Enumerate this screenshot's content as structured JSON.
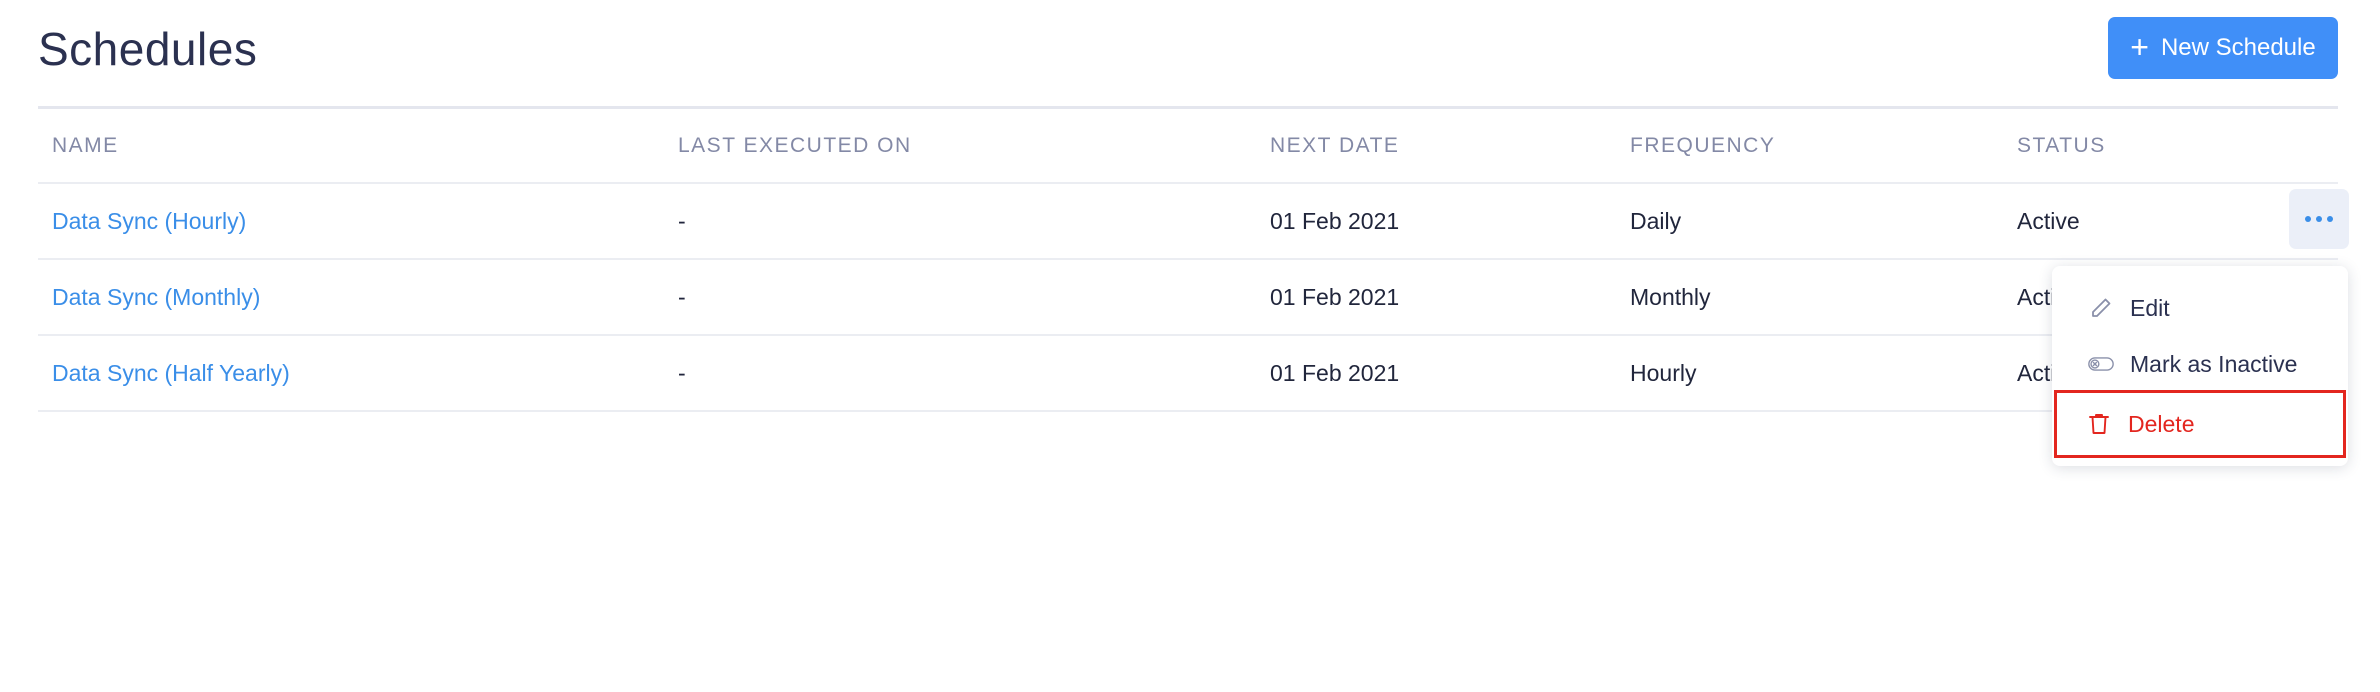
{
  "page": {
    "title": "Schedules",
    "new_button_label": "New Schedule",
    "new_button_icon": "plus-icon"
  },
  "table": {
    "columns": [
      "NAME",
      "LAST EXECUTED ON",
      "NEXT DATE",
      "FREQUENCY",
      "STATUS"
    ],
    "rows": [
      {
        "name": "Data Sync (Hourly)",
        "last_executed": "-",
        "next_date": "01 Feb 2021",
        "frequency": "Daily",
        "status": "Active"
      },
      {
        "name": "Data Sync (Monthly)",
        "last_executed": "-",
        "next_date": "01 Feb 2021",
        "frequency": "Monthly",
        "status": "Active"
      },
      {
        "name": "Data Sync (Half Yearly)",
        "last_executed": "-",
        "next_date": "01 Feb 2021",
        "frequency": "Hourly",
        "status": "Active"
      }
    ]
  },
  "row_menu": {
    "trigger_icon": "more-horizontal-icon",
    "items": [
      {
        "label": "Edit",
        "icon": "pencil-icon"
      },
      {
        "label": "Mark as Inactive",
        "icon": "toggle-off-icon"
      },
      {
        "label": "Delete",
        "icon": "trash-icon",
        "highlighted": true
      }
    ]
  },
  "colors": {
    "accent": "#408ff8",
    "link": "#3a8ee8",
    "danger": "#e3261f",
    "header_text": "#8389a6",
    "body_text": "#21263c"
  }
}
